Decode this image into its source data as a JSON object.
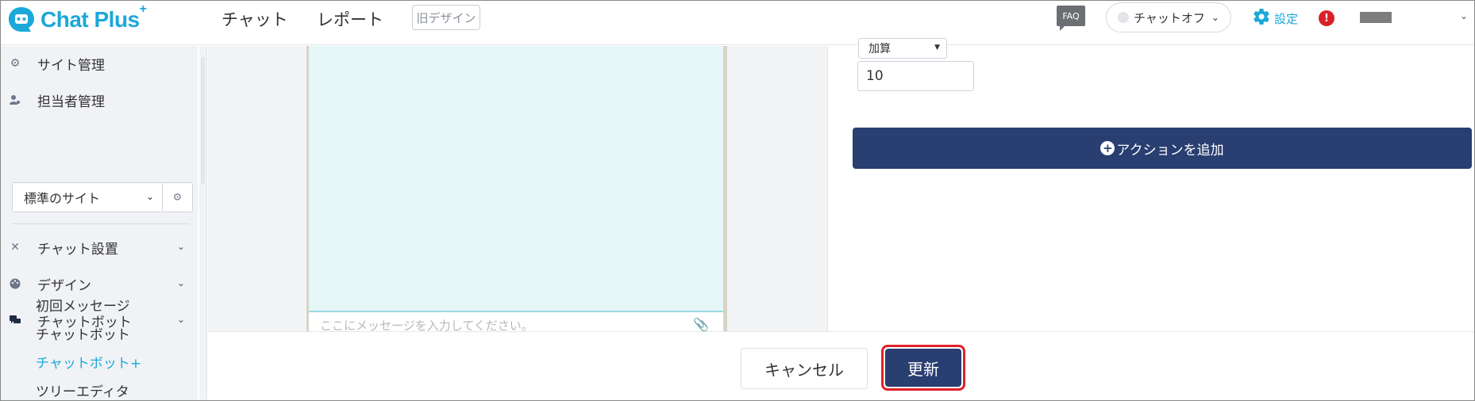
{
  "header": {
    "logo_text": "Chat Plus",
    "logo_sup": "+",
    "nav": [
      "チャット",
      "レポート"
    ],
    "old_design": "旧デザイン",
    "faq": "FAQ",
    "chat_status": "チャットオフ",
    "settings_label": "設定",
    "alert_mark": "!"
  },
  "sidebar": {
    "top_items": [
      "サイト管理",
      "担当者管理"
    ],
    "site_select": "標準のサイト",
    "sections": [
      "チャット設置",
      "デザイン",
      "チャットボット"
    ],
    "sub_items": [
      "初回メッセージ",
      "チャットボット",
      "チャットボット+",
      "ツリーエディタ"
    ]
  },
  "preview": {
    "input_placeholder": "ここにメッセージを入力してください。"
  },
  "panel": {
    "calc_select": "加算",
    "value": "10",
    "add_action": "アクションを追加"
  },
  "footer": {
    "cancel": "キャンセル",
    "update": "更新"
  },
  "colors": {
    "brand": "#1ba8d8",
    "navy": "#293e71",
    "highlight": "#e0202a",
    "alert": "#d8222a"
  }
}
